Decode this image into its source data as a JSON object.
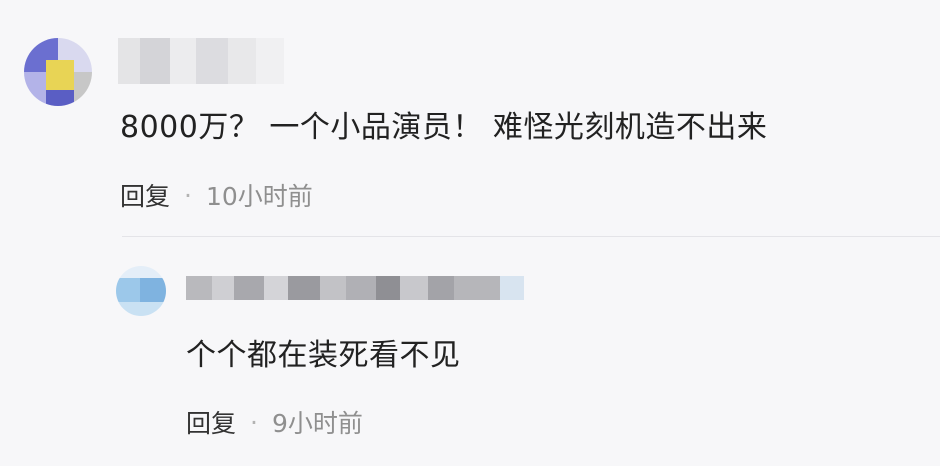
{
  "comments": [
    {
      "id": "top-comment",
      "username_blurred": true,
      "text": "8000万？  一个小品演员！  难怪光刻机造不出来",
      "reply_label": "回复",
      "separator": "·",
      "time": "10小时前",
      "colors": {
        "avatar_pixels": [
          "#6b6fd0",
          "#e8d455",
          "#b3b3e8",
          "#c7c7c7",
          "#5a5ec4",
          "#d9d9ef"
        ],
        "name_blocks": [
          "#e4e4e6",
          "#d4d4d8",
          "#ececee",
          "#dcdce0",
          "#e8e8ea",
          "#f0f0f2"
        ]
      }
    },
    {
      "id": "reply-comment",
      "username_blurred": true,
      "text": "个个都在装死看不见",
      "reply_label": "回复",
      "separator": "·",
      "time": "9小时前",
      "colors": {
        "avatar_pixels": [
          "#9cc8ea",
          "#7fb3e0",
          "#c9e1f3",
          "#e4eef8"
        ],
        "name_blocks": [
          "#b9b9bd",
          "#cfcfd3",
          "#a8a8ad",
          "#d4d4d8",
          "#9a9a9f",
          "#c2c2c6",
          "#b0b0b5",
          "#8f8f94",
          "#c8c8cc",
          "#a3a3a8",
          "#b6b6ba",
          "#d8e4f0"
        ]
      }
    }
  ]
}
